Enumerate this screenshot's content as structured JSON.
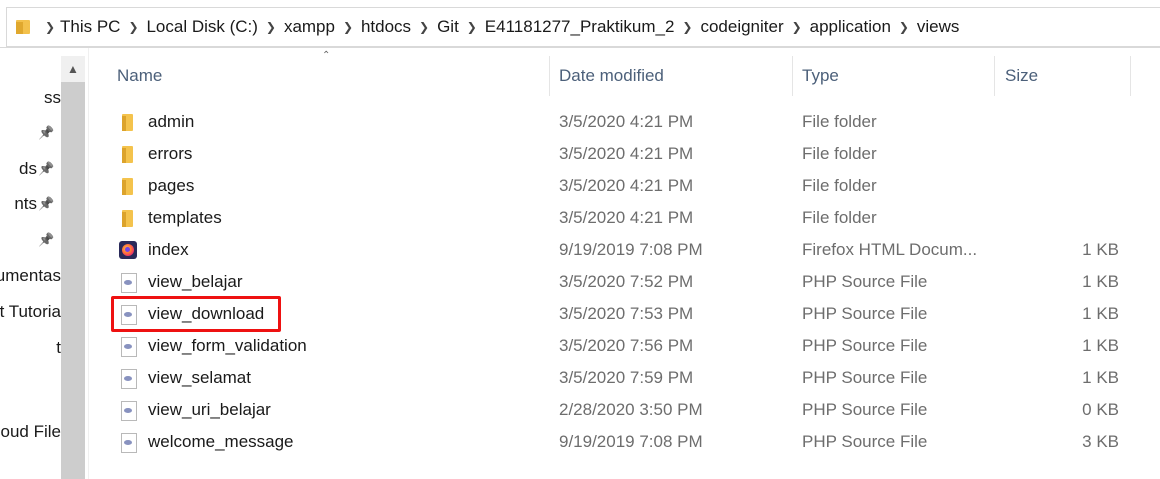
{
  "address_bar": {
    "breadcrumbs": [
      "This PC",
      "Local Disk (C:)",
      "xampp",
      "htdocs",
      "Git",
      "E41181277_Praktikum_2",
      "codeigniter",
      "application",
      "views"
    ]
  },
  "nav_pane": {
    "items": [
      {
        "label": "ss",
        "pinned": false
      },
      {
        "label": "",
        "pinned": true
      },
      {
        "label": "ds",
        "pinned": true
      },
      {
        "label": "nts",
        "pinned": true
      },
      {
        "label": "",
        "pinned": true
      },
      {
        "label": "umentas",
        "pinned": false
      },
      {
        "label": "t Tutoria",
        "pinned": false
      },
      {
        "label": "t",
        "pinned": false
      },
      {
        "label": "oud File",
        "pinned": false
      }
    ]
  },
  "columns": {
    "name": "Name",
    "date": "Date modified",
    "type": "Type",
    "size": "Size"
  },
  "files": [
    {
      "name": "admin",
      "date": "3/5/2020 4:21 PM",
      "type": "File folder",
      "size": "",
      "icon": "folder-icon"
    },
    {
      "name": "errors",
      "date": "3/5/2020 4:21 PM",
      "type": "File folder",
      "size": "",
      "icon": "folder-icon"
    },
    {
      "name": "pages",
      "date": "3/5/2020 4:21 PM",
      "type": "File folder",
      "size": "",
      "icon": "folder-icon"
    },
    {
      "name": "templates",
      "date": "3/5/2020 4:21 PM",
      "type": "File folder",
      "size": "",
      "icon": "folder-icon"
    },
    {
      "name": "index",
      "date": "9/19/2019 7:08 PM",
      "type": "Firefox HTML Docum...",
      "size": "1 KB",
      "icon": "firefox-icon"
    },
    {
      "name": "view_belajar",
      "date": "3/5/2020 7:52 PM",
      "type": "PHP Source File",
      "size": "1 KB",
      "icon": "php-icon"
    },
    {
      "name": "view_download",
      "date": "3/5/2020 7:53 PM",
      "type": "PHP Source File",
      "size": "1 KB",
      "icon": "php-icon"
    },
    {
      "name": "view_form_validation",
      "date": "3/5/2020 7:56 PM",
      "type": "PHP Source File",
      "size": "1 KB",
      "icon": "php-icon"
    },
    {
      "name": "view_selamat",
      "date": "3/5/2020 7:59 PM",
      "type": "PHP Source File",
      "size": "1 KB",
      "icon": "php-icon"
    },
    {
      "name": "view_uri_belajar",
      "date": "2/28/2020 3:50 PM",
      "type": "PHP Source File",
      "size": "0 KB",
      "icon": "php-icon"
    },
    {
      "name": "welcome_message",
      "date": "9/19/2019 7:08 PM",
      "type": "PHP Source File",
      "size": "3 KB",
      "icon": "php-icon"
    }
  ],
  "highlighted_file": "view_download",
  "colors": {
    "header_text": "#4c607a",
    "highlight_border": "#ee1111",
    "folder": "#f4c34d"
  }
}
